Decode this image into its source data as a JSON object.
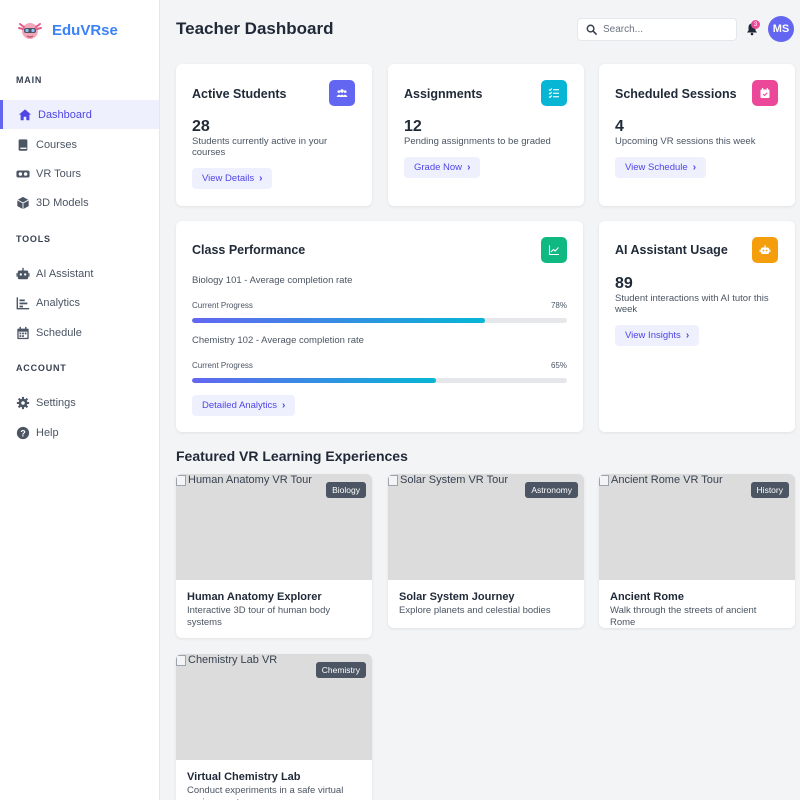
{
  "app": {
    "name": "EduVRse"
  },
  "sidebar": {
    "sections": [
      {
        "label": "MAIN",
        "items": [
          {
            "label": "Dashboard",
            "icon": "home-icon",
            "active": true
          },
          {
            "label": "Courses",
            "icon": "book-icon"
          },
          {
            "label": "VR Tours",
            "icon": "vr-headset-icon"
          },
          {
            "label": "3D Models",
            "icon": "cube-icon"
          }
        ]
      },
      {
        "label": "TOOLS",
        "items": [
          {
            "label": "AI Assistant",
            "icon": "robot-icon"
          },
          {
            "label": "Analytics",
            "icon": "bar-chart-icon"
          },
          {
            "label": "Schedule",
            "icon": "calendar-icon"
          }
        ]
      },
      {
        "label": "ACCOUNT",
        "items": [
          {
            "label": "Settings",
            "icon": "gear-icon"
          },
          {
            "label": "Help",
            "icon": "question-circle-icon"
          }
        ]
      }
    ]
  },
  "header": {
    "title": "Teacher Dashboard",
    "search_placeholder": "Search...",
    "notification_count": "3",
    "avatar_initials": "MS"
  },
  "stats": [
    {
      "title": "Active Students",
      "value": "28",
      "description": "Students currently active in your courses",
      "button": "View Details",
      "icon": "users-icon",
      "color": "#6366f1"
    },
    {
      "title": "Assignments",
      "value": "12",
      "description": "Pending assignments to be graded",
      "button": "Grade Now",
      "icon": "checklist-icon",
      "color": "#06b6d4"
    },
    {
      "title": "Scheduled Sessions",
      "value": "4",
      "description": "Upcoming VR sessions this week",
      "button": "View Schedule",
      "icon": "calendar-check-icon",
      "color": "#ec4899"
    }
  ],
  "performance": {
    "title": "Class Performance",
    "icon": "line-chart-icon",
    "color": "#10b981",
    "courses": [
      {
        "name": "Biology 101 - Average completion rate",
        "progress_label": "Current Progress",
        "percent_text": "78%",
        "percent": 78
      },
      {
        "name": "Chemistry 102 - Average completion rate",
        "progress_label": "Current Progress",
        "percent_text": "65%",
        "percent": 65
      }
    ],
    "button": "Detailed Analytics"
  },
  "ai_usage": {
    "title": "AI Assistant Usage",
    "value": "89",
    "description": "Student interactions with AI tutor this week",
    "button": "View Insights",
    "icon": "robot-icon",
    "color": "#f59e0b"
  },
  "featured": {
    "title": "Featured VR Learning Experiences",
    "items": [
      {
        "alt": "Human Anatomy VR Tour",
        "tag": "Biology",
        "title": "Human Anatomy Explorer",
        "description": "Interactive 3D tour of human body systems"
      },
      {
        "alt": "Solar System VR Tour",
        "tag": "Astronomy",
        "title": "Solar System Journey",
        "description": "Explore planets and celestial bodies"
      },
      {
        "alt": "Ancient Rome VR Tour",
        "tag": "History",
        "title": "Ancient Rome",
        "description": "Walk through the streets of ancient Rome"
      },
      {
        "alt": "Chemistry Lab VR",
        "tag": "Chemistry",
        "title": "Virtual Chemistry Lab",
        "description": "Conduct experiments in a safe virtual environment"
      }
    ]
  }
}
